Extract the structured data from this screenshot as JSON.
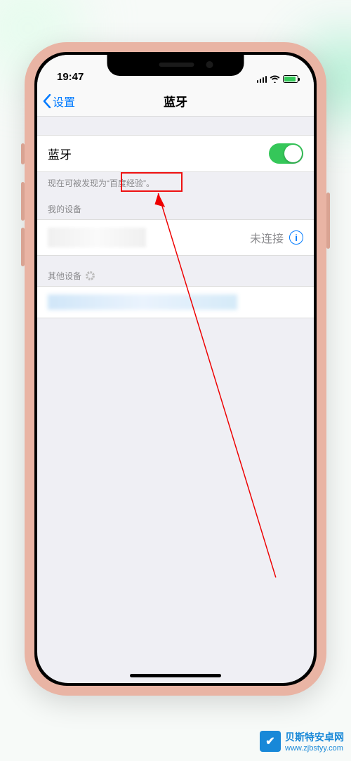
{
  "status": {
    "time": "19:47"
  },
  "nav": {
    "back": "设置",
    "title": "蓝牙"
  },
  "bluetooth": {
    "label": "蓝牙",
    "enabled": true,
    "discoverable_text": "现在可被发现为“百度经验”。"
  },
  "my_devices": {
    "header": "我的设备",
    "status": "未连接"
  },
  "other_devices": {
    "header": "其他设备"
  },
  "watermark": {
    "title": "贝斯特安卓网",
    "url": "www.zjbstyy.com"
  }
}
